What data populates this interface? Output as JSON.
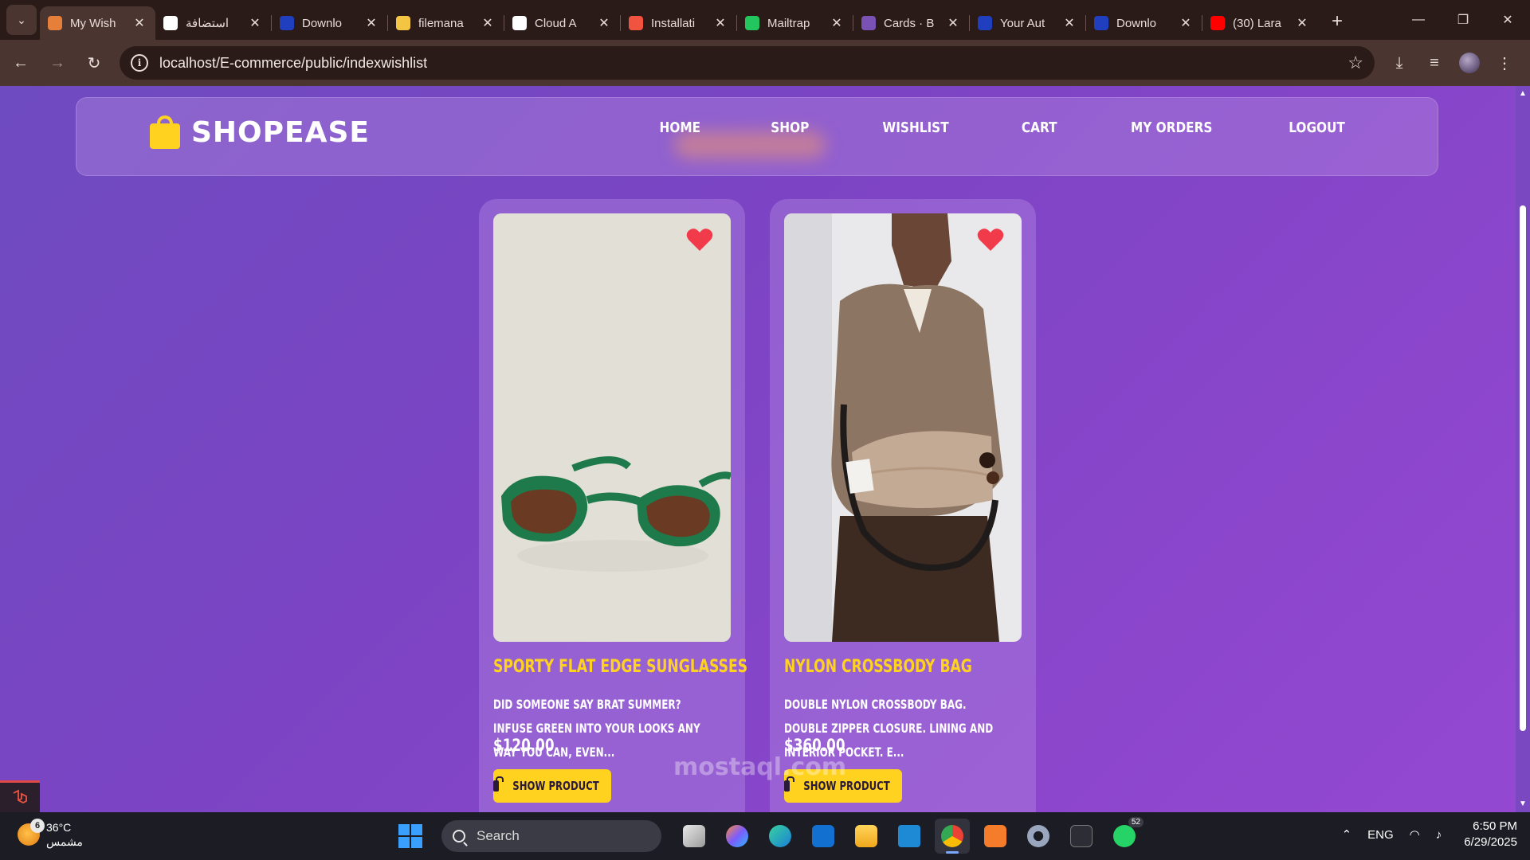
{
  "browser": {
    "tabs": [
      {
        "title": "My Wish",
        "favicon": "xampp-icon",
        "color": "#e57f3a",
        "active": true
      },
      {
        "title": "استضافة",
        "favicon": "openai-icon",
        "color": "#ffffff",
        "active": false
      },
      {
        "title": "Downlo",
        "favicon": "n-icon",
        "color": "#1f3fbf",
        "active": false
      },
      {
        "title": "filemana",
        "favicon": "shield-icon",
        "color": "#f4c542",
        "active": false
      },
      {
        "title": "Cloud A",
        "favicon": "cloud-icon",
        "color": "#ffffff",
        "active": false
      },
      {
        "title": "Installati",
        "favicon": "laravel-icon",
        "color": "#f05340",
        "active": false
      },
      {
        "title": "Mailtrap",
        "favicon": "mailtrap-icon",
        "color": "#22c55e",
        "active": false
      },
      {
        "title": "Cards · B",
        "favicon": "bootstrap-icon",
        "color": "#7952b3",
        "active": false
      },
      {
        "title": "Your Aut",
        "favicon": "n-icon",
        "color": "#1f3fbf",
        "active": false
      },
      {
        "title": "Downlo",
        "favicon": "n-icon",
        "color": "#1f3fbf",
        "active": false
      },
      {
        "title": "(30) Lara",
        "favicon": "youtube-icon",
        "color": "#ff0000",
        "active": false
      }
    ],
    "url": "localhost/E-commerce/public/indexwishlist"
  },
  "site": {
    "brand": "SHOPEASE",
    "nav": [
      "HOME",
      "SHOP",
      "WISHLIST",
      "CART",
      "MY ORDERS",
      "LOGOUT"
    ],
    "accent": "#ffd21f"
  },
  "wishlist": [
    {
      "title": "SPORTY FLAT EDGE SUNGLASSES",
      "desc": "DID SOMEONE SAY BRAT SUMMER? INFUSE GREEN INTO YOUR LOOKS ANY WAY YOU CAN, EVEN...",
      "price": "$120.00",
      "button": "SHOW PRODUCT"
    },
    {
      "title": "NYLON CROSSBODY BAG",
      "desc": "DOUBLE NYLON CROSSBODY BAG. DOUBLE ZIPPER CLOSURE. LINING AND INTERIOR POCKET. E...",
      "price": "$360.00",
      "button": "SHOW PRODUCT"
    }
  ],
  "watermark": "mostaql.com",
  "taskbar": {
    "weather_temp": "36°C",
    "weather_desc": "مشمس",
    "weather_badge": "6",
    "search_placeholder": "Search",
    "whatsapp_badge": "52",
    "lang": "ENG",
    "time": "6:50 PM",
    "date": "6/29/2025"
  }
}
